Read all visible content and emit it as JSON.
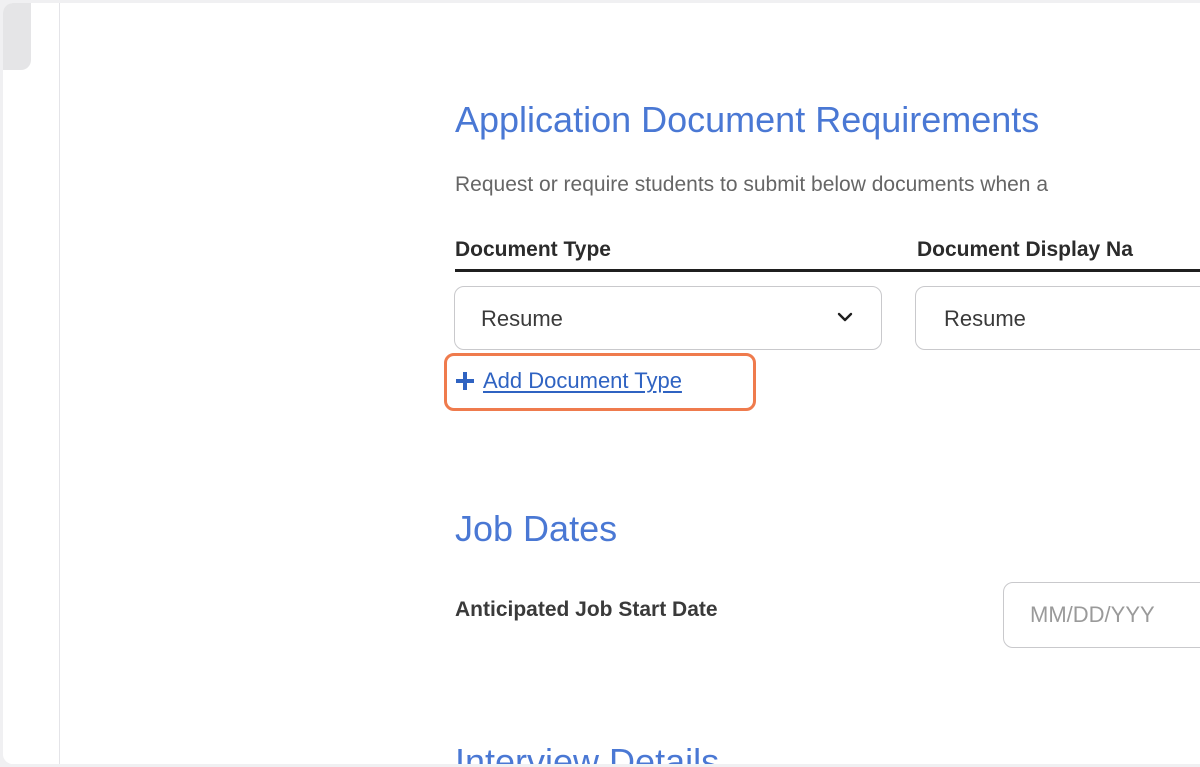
{
  "documents_section": {
    "title": "Application Document Requirements",
    "description": "Request or require students to submit below documents when a",
    "columns": {
      "document_type": "Document Type",
      "display_name": "Document Display Na"
    },
    "rows": [
      {
        "document_type": "Resume",
        "display_name": "Resume"
      }
    ],
    "add_document_label": " Add Document Type",
    "highlight_color": "#ef7b4d"
  },
  "job_dates_section": {
    "title": "Job Dates",
    "start_date_label": "Anticipated Job Start Date",
    "start_date_placeholder": "MM/DD/YYY"
  },
  "interview_section": {
    "title": "Interview Details"
  },
  "colors": {
    "section_title": "#4a78d4",
    "link": "#2f63c2"
  }
}
